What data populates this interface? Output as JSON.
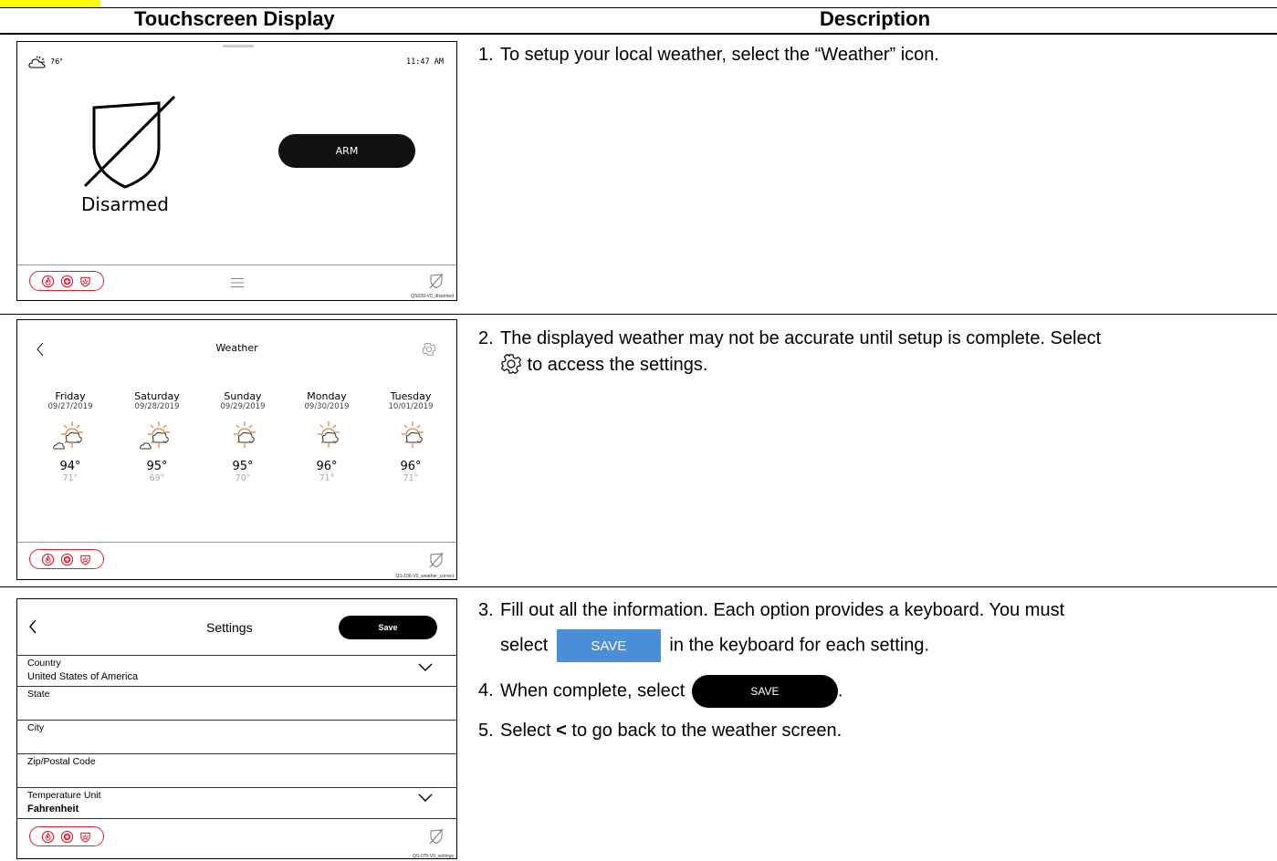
{
  "columns": {
    "display": "Touchscreen Display",
    "description": "Description"
  },
  "panel1": {
    "temp": "76°",
    "time": "11:47 AM",
    "status": "Disarmed",
    "arm_button": "ARM",
    "image_id": "QS039-V0_disarmed"
  },
  "panel2": {
    "title": "Weather",
    "image_id": "QS-106-V0_weather_correct",
    "days": [
      {
        "name": "Friday",
        "date": "09/27/2019",
        "high": "94°",
        "low": "71°"
      },
      {
        "name": "Saturday",
        "date": "09/28/2019",
        "high": "95°",
        "low": "69°"
      },
      {
        "name": "Sunday",
        "date": "09/29/2019",
        "high": "95°",
        "low": "70°"
      },
      {
        "name": "Monday",
        "date": "09/30/2019",
        "high": "96°",
        "low": "71°"
      },
      {
        "name": "Tuesday",
        "date": "10/01/2019",
        "high": "96°",
        "low": "71°"
      }
    ]
  },
  "panel3": {
    "title": "Settings",
    "save": "Save",
    "image_id": "QS-075-V0_settings",
    "fields": [
      {
        "label": "Country",
        "value": "United States of America"
      },
      {
        "label": "State",
        "value": ""
      },
      {
        "label": "City",
        "value": ""
      },
      {
        "label": "Zip/Postal Code",
        "value": ""
      },
      {
        "label": "Temperature Unit",
        "value": "Fahrenheit"
      }
    ]
  },
  "steps": {
    "s1_num": "1.",
    "s1": "To setup your local weather, select the “Weather” icon.",
    "s2_num": "2.",
    "s2_a": "The displayed weather may not be accurate until setup is complete.  Select",
    "s2_b": "to access the settings.",
    "s3_num": "3.",
    "s3_a": "Fill out all the information.  Each option provides a keyboard.  You must",
    "s3_b": "select",
    "s3_btn": "SAVE",
    "s3_c": "in the keyboard for each setting.",
    "s4_num": "4.",
    "s4_a": "When complete, select",
    "s4_btn": "SAVE",
    "s4_c": ".",
    "s5_num": "5.",
    "s5_a": "Select",
    "s5_lt": "<",
    "s5_b": "to go back to the weather screen."
  },
  "colors": {
    "highlight": "#ffff00",
    "emergency_red": "#d22233",
    "sun_orange": "#e07a3a",
    "save_blue": "#4a8fd7"
  }
}
